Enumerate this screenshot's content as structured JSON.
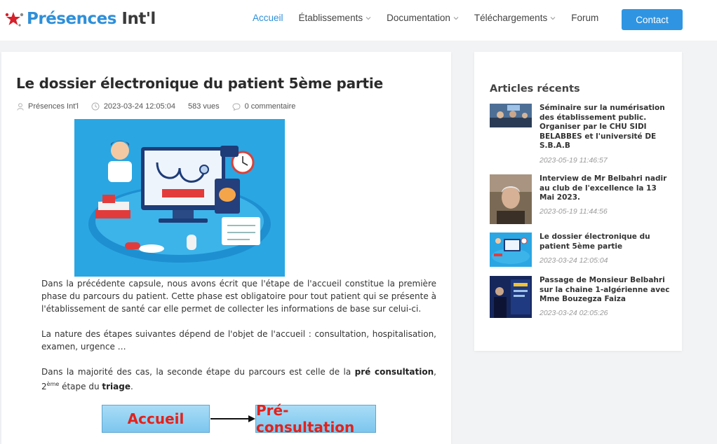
{
  "logo": {
    "brand": "Présences",
    "suffix": " Int'l"
  },
  "nav": {
    "items": [
      {
        "label": "Accueil",
        "active": true,
        "dropdown": false
      },
      {
        "label": "Établissements",
        "active": false,
        "dropdown": true
      },
      {
        "label": "Documentation",
        "active": false,
        "dropdown": true
      },
      {
        "label": "Téléchargements",
        "active": false,
        "dropdown": true
      },
      {
        "label": "Forum",
        "active": false,
        "dropdown": false
      }
    ],
    "contact_label": "Contact"
  },
  "post": {
    "title": "Le dossier électronique du patient 5ème partie",
    "author": "Présences Int'l",
    "date": "2023-03-24 12:05:04",
    "views": "583 vues",
    "comments": "0 commentaire",
    "para1": "Dans la précédente capsule, nous avons écrit que l'étape de l'accueil constitue la première phase du parcours du patient.  Cette phase est obligatoire pour tout patient qui se présente à l'établissement de santé car elle permet de collecter les informations de base sur celui-ci.",
    "para2": "La nature des étapes suivantes dépend de l'objet de l'accueil : consultation, hospitalisation, examen, urgence …",
    "para3_a": "Dans la majorité des cas, la seconde étape du parcours est celle de la ",
    "para3_b": "pré consultation",
    "para3_c": ", 2",
    "para3_sup": "ème",
    "para3_d": " étape du ",
    "para3_e": "triage",
    "para3_f": ".",
    "diagram_box1": "Accueil",
    "diagram_box2": "Pré-consultation"
  },
  "sidebar": {
    "title": "Articles récents",
    "articles": [
      {
        "title": "Séminaire sur la numérisation des établissement public. Organiser par le CHU SIDI BELABBES et l'université DE S.B.A.B",
        "date": "2023-05-19 11:46:57"
      },
      {
        "title": "Interview de Mr Belbahri nadir au club de l'excellence la 13 Mai 2023.",
        "date": "2023-05-19 11:44:56"
      },
      {
        "title": "Le dossier électronique du patient 5ème partie",
        "date": "2023-03-24 12:05:04"
      },
      {
        "title": "Passage de Monsieur Belbahri sur la chaine 1-algérienne avec Mme Bouzegza Faiza",
        "date": "2023-03-24 02:05:26"
      }
    ]
  },
  "colors": {
    "accent": "#2f95e2",
    "nav_active": "#2f8fd8"
  }
}
